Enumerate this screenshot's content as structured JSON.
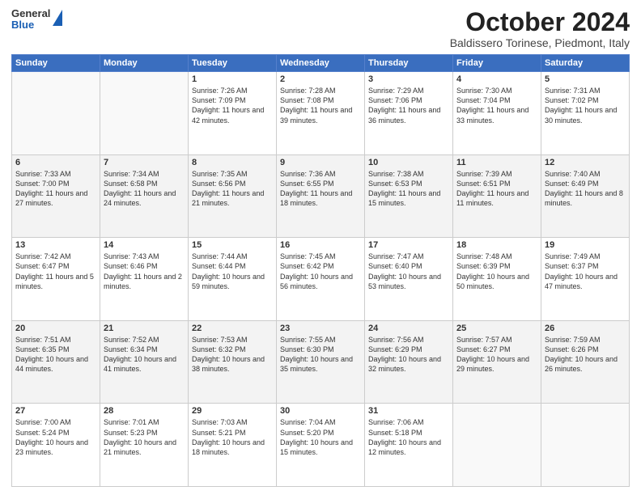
{
  "logo": {
    "general": "General",
    "blue": "Blue"
  },
  "header": {
    "month": "October 2024",
    "location": "Baldissero Torinese, Piedmont, Italy"
  },
  "weekdays": [
    "Sunday",
    "Monday",
    "Tuesday",
    "Wednesday",
    "Thursday",
    "Friday",
    "Saturday"
  ],
  "weeks": [
    [
      {
        "day": "",
        "info": ""
      },
      {
        "day": "",
        "info": ""
      },
      {
        "day": "1",
        "info": "Sunrise: 7:26 AM\nSunset: 7:09 PM\nDaylight: 11 hours and 42 minutes."
      },
      {
        "day": "2",
        "info": "Sunrise: 7:28 AM\nSunset: 7:08 PM\nDaylight: 11 hours and 39 minutes."
      },
      {
        "day": "3",
        "info": "Sunrise: 7:29 AM\nSunset: 7:06 PM\nDaylight: 11 hours and 36 minutes."
      },
      {
        "day": "4",
        "info": "Sunrise: 7:30 AM\nSunset: 7:04 PM\nDaylight: 11 hours and 33 minutes."
      },
      {
        "day": "5",
        "info": "Sunrise: 7:31 AM\nSunset: 7:02 PM\nDaylight: 11 hours and 30 minutes."
      }
    ],
    [
      {
        "day": "6",
        "info": "Sunrise: 7:33 AM\nSunset: 7:00 PM\nDaylight: 11 hours and 27 minutes."
      },
      {
        "day": "7",
        "info": "Sunrise: 7:34 AM\nSunset: 6:58 PM\nDaylight: 11 hours and 24 minutes."
      },
      {
        "day": "8",
        "info": "Sunrise: 7:35 AM\nSunset: 6:56 PM\nDaylight: 11 hours and 21 minutes."
      },
      {
        "day": "9",
        "info": "Sunrise: 7:36 AM\nSunset: 6:55 PM\nDaylight: 11 hours and 18 minutes."
      },
      {
        "day": "10",
        "info": "Sunrise: 7:38 AM\nSunset: 6:53 PM\nDaylight: 11 hours and 15 minutes."
      },
      {
        "day": "11",
        "info": "Sunrise: 7:39 AM\nSunset: 6:51 PM\nDaylight: 11 hours and 11 minutes."
      },
      {
        "day": "12",
        "info": "Sunrise: 7:40 AM\nSunset: 6:49 PM\nDaylight: 11 hours and 8 minutes."
      }
    ],
    [
      {
        "day": "13",
        "info": "Sunrise: 7:42 AM\nSunset: 6:47 PM\nDaylight: 11 hours and 5 minutes."
      },
      {
        "day": "14",
        "info": "Sunrise: 7:43 AM\nSunset: 6:46 PM\nDaylight: 11 hours and 2 minutes."
      },
      {
        "day": "15",
        "info": "Sunrise: 7:44 AM\nSunset: 6:44 PM\nDaylight: 10 hours and 59 minutes."
      },
      {
        "day": "16",
        "info": "Sunrise: 7:45 AM\nSunset: 6:42 PM\nDaylight: 10 hours and 56 minutes."
      },
      {
        "day": "17",
        "info": "Sunrise: 7:47 AM\nSunset: 6:40 PM\nDaylight: 10 hours and 53 minutes."
      },
      {
        "day": "18",
        "info": "Sunrise: 7:48 AM\nSunset: 6:39 PM\nDaylight: 10 hours and 50 minutes."
      },
      {
        "day": "19",
        "info": "Sunrise: 7:49 AM\nSunset: 6:37 PM\nDaylight: 10 hours and 47 minutes."
      }
    ],
    [
      {
        "day": "20",
        "info": "Sunrise: 7:51 AM\nSunset: 6:35 PM\nDaylight: 10 hours and 44 minutes."
      },
      {
        "day": "21",
        "info": "Sunrise: 7:52 AM\nSunset: 6:34 PM\nDaylight: 10 hours and 41 minutes."
      },
      {
        "day": "22",
        "info": "Sunrise: 7:53 AM\nSunset: 6:32 PM\nDaylight: 10 hours and 38 minutes."
      },
      {
        "day": "23",
        "info": "Sunrise: 7:55 AM\nSunset: 6:30 PM\nDaylight: 10 hours and 35 minutes."
      },
      {
        "day": "24",
        "info": "Sunrise: 7:56 AM\nSunset: 6:29 PM\nDaylight: 10 hours and 32 minutes."
      },
      {
        "day": "25",
        "info": "Sunrise: 7:57 AM\nSunset: 6:27 PM\nDaylight: 10 hours and 29 minutes."
      },
      {
        "day": "26",
        "info": "Sunrise: 7:59 AM\nSunset: 6:26 PM\nDaylight: 10 hours and 26 minutes."
      }
    ],
    [
      {
        "day": "27",
        "info": "Sunrise: 7:00 AM\nSunset: 5:24 PM\nDaylight: 10 hours and 23 minutes."
      },
      {
        "day": "28",
        "info": "Sunrise: 7:01 AM\nSunset: 5:23 PM\nDaylight: 10 hours and 21 minutes."
      },
      {
        "day": "29",
        "info": "Sunrise: 7:03 AM\nSunset: 5:21 PM\nDaylight: 10 hours and 18 minutes."
      },
      {
        "day": "30",
        "info": "Sunrise: 7:04 AM\nSunset: 5:20 PM\nDaylight: 10 hours and 15 minutes."
      },
      {
        "day": "31",
        "info": "Sunrise: 7:06 AM\nSunset: 5:18 PM\nDaylight: 10 hours and 12 minutes."
      },
      {
        "day": "",
        "info": ""
      },
      {
        "day": "",
        "info": ""
      }
    ]
  ]
}
